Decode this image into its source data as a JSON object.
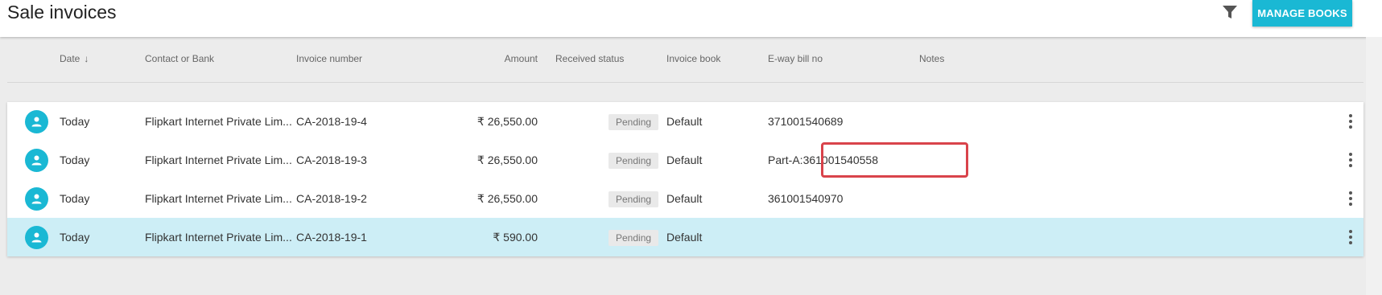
{
  "header": {
    "title": "Sale invoices",
    "filter_icon": "filter-icon",
    "manage_books_label": "MANAGE BOOKS",
    "accent_color": "#1ab8d4"
  },
  "table": {
    "columns": {
      "date": "Date",
      "contact": "Contact or Bank",
      "invoice_number": "Invoice number",
      "amount": "Amount",
      "received_status": "Received status",
      "invoice_book": "Invoice book",
      "eway_bill": "E-way bill no",
      "notes": "Notes"
    },
    "sort_icon": "arrow-down-icon",
    "rows": [
      {
        "date": "Today",
        "contact": "Flipkart Internet Private Lim...",
        "invoice_number": "CA-2018-19-4",
        "amount": "₹ 26,550.00",
        "status": "Pending",
        "book": "Default",
        "eway": "371001540689",
        "notes": "",
        "selected": false
      },
      {
        "date": "Today",
        "contact": "Flipkart Internet Private Lim...",
        "invoice_number": "CA-2018-19-3",
        "amount": "₹ 26,550.00",
        "status": "Pending",
        "book": "Default",
        "eway": "Part-A:361001540558",
        "notes": "",
        "selected": false,
        "highlighted": true
      },
      {
        "date": "Today",
        "contact": "Flipkart Internet Private Lim...",
        "invoice_number": "CA-2018-19-2",
        "amount": "₹ 26,550.00",
        "status": "Pending",
        "book": "Default",
        "eway": "361001540970",
        "notes": "",
        "selected": false
      },
      {
        "date": "Today",
        "contact": "Flipkart Internet Private Lim...",
        "invoice_number": "CA-2018-19-1",
        "amount": "₹ 590.00",
        "status": "Pending",
        "book": "Default",
        "eway": "",
        "notes": "",
        "selected": true
      }
    ]
  },
  "colors": {
    "selected_row": "#cdeef6",
    "highlight_border": "#d9434b",
    "badge_bg": "#e9e9e9"
  }
}
